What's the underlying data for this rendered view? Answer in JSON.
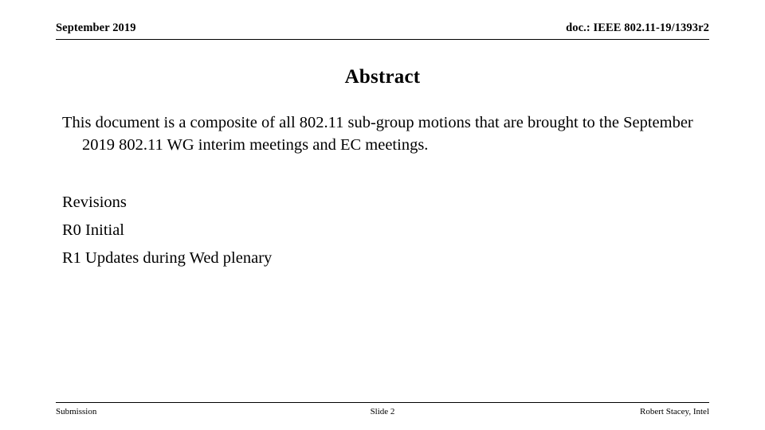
{
  "slide": {
    "header": {
      "left_text": "September 2019",
      "right_text": "doc.: IEEE 802.11-19/1393r2"
    },
    "title": "Abstract",
    "body": {
      "abstract_paragraph": "This document is a composite of all 802.11 sub-group motions that are brought to the September 2019 802.11 WG interim meetings and EC meetings.",
      "revisions": [
        "Revisions",
        "R0 Initial",
        "R1 Updates during Wed plenary"
      ]
    },
    "footer": {
      "left_text": "Submission",
      "center_text": "Slide 2",
      "right_text": "Robert Stacey, Intel"
    },
    "colors": {
      "background": "#ffffff",
      "text": "#000000",
      "rule": "#000000"
    }
  }
}
